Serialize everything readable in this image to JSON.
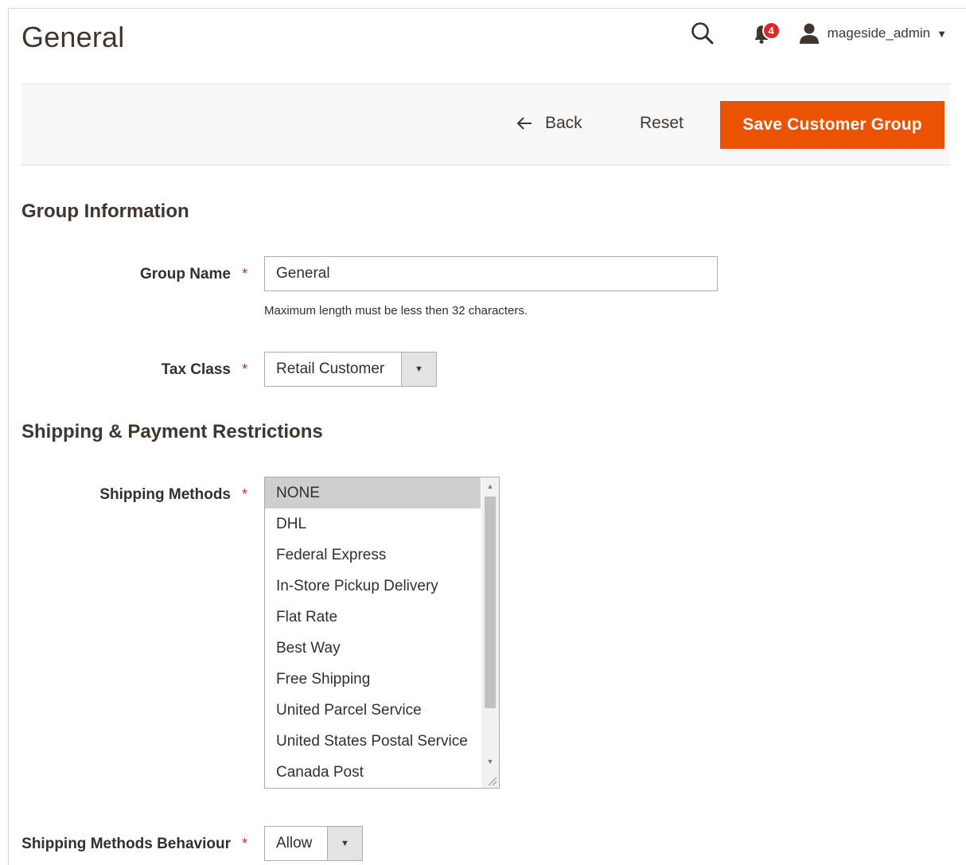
{
  "header": {
    "title": "General",
    "notification_count": "4",
    "user_name": "mageside_admin"
  },
  "action_bar": {
    "back_label": "Back",
    "reset_label": "Reset",
    "save_label": "Save Customer Group",
    "save_color": "#eb5202"
  },
  "group_information": {
    "section_title": "Group Information",
    "group_name": {
      "label": "Group Name",
      "value": "General",
      "note": "Maximum length must be less then 32 characters."
    },
    "tax_class": {
      "label": "Tax Class",
      "value": "Retail Customer"
    }
  },
  "restrictions": {
    "section_title": "Shipping & Payment Restrictions",
    "shipping_methods": {
      "label": "Shipping Methods",
      "options": [
        "NONE",
        "DHL",
        "Federal Express",
        "In-Store Pickup Delivery",
        "Flat Rate",
        "Best Way",
        "Free Shipping",
        "United Parcel Service",
        "United States Postal Service",
        "Canada Post"
      ],
      "selected": "NONE"
    },
    "shipping_behaviour": {
      "label": "Shipping Methods Behaviour",
      "value": "Allow"
    }
  },
  "colors": {
    "required_asterisk": "#e22626",
    "badge": "#e22626"
  },
  "icons": {
    "search": "search-icon",
    "notifications": "bell-icon",
    "user": "user-icon",
    "back": "arrow-left-icon",
    "dropdown": "triangle-down-icon"
  }
}
